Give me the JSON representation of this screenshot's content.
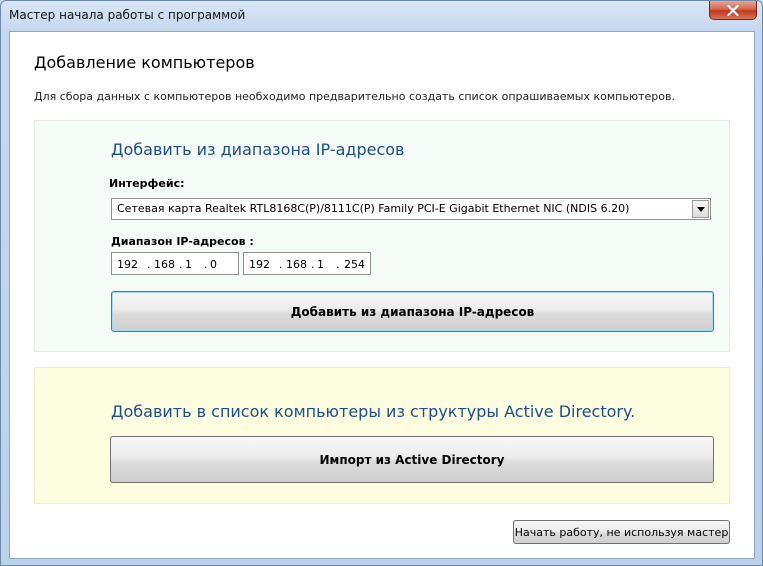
{
  "window": {
    "title": "Мастер начала работы с программой"
  },
  "page": {
    "title": "Добавление компьютеров",
    "description": "Для сбора данных с компьютеров необходимо предварительно создать список опрашиваемых компьютеров."
  },
  "ip_section": {
    "heading": "Добавить из диапазона IP-адресов",
    "interface_label": "Интерфейс:",
    "interface_value": "Сетевая карта Realtek RTL8168C(P)/8111C(P) Family PCI-E Gigabit Ethernet NIC (NDIS 6.20)",
    "range_label": "Диапазон IP-адресов :",
    "ip_from": [
      "192",
      "168",
      "1",
      "0"
    ],
    "ip_to": [
      "192",
      "168",
      "1",
      "254"
    ],
    "add_button": "Добавить из диапазона IP-адресов"
  },
  "ad_section": {
    "heading": "Добавить в список компьютеры из структуры Active Directory.",
    "import_button": "Импорт из Active Directory"
  },
  "footer": {
    "skip_button": "Начать работу, не используя мастер"
  },
  "colors": {
    "heading_blue": "#1d4f8c",
    "ip_panel_bg": "#f5fbf7",
    "ad_panel_bg": "#fdfde0",
    "close_red": "#c3361b"
  }
}
